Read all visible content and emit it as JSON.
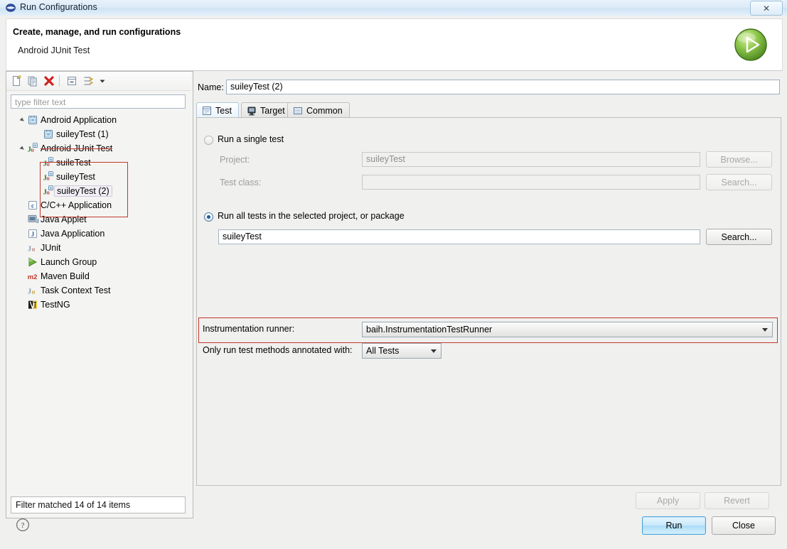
{
  "window": {
    "title": "Run Configurations",
    "icon": "eclipse-icon",
    "close_label": "✕"
  },
  "header": {
    "title": "Create, manage, and run configurations",
    "subtitle": "Android JUnit Test",
    "run_icon": "green-run-icon"
  },
  "sidebar": {
    "toolbar": [
      {
        "name": "new-configuration-icon",
        "label": "New launch configuration"
      },
      {
        "name": "duplicate-configuration-icon",
        "label": "Duplicate"
      },
      {
        "name": "delete-configuration-icon",
        "label": "Delete"
      },
      {
        "name": "collapse-all-icon",
        "label": "Collapse All"
      },
      {
        "name": "filter-icon",
        "label": "Filter"
      },
      {
        "name": "chevron-down-icon",
        "label": "Menu"
      }
    ],
    "filter": {
      "placeholder": "type filter text",
      "value": ""
    },
    "tree": [
      {
        "label": "Android Application",
        "icon": "android-app-icon",
        "depth": 0,
        "expanded": true,
        "selected": false,
        "struck": false
      },
      {
        "label": "suileyTest (1)",
        "icon": "android-app-icon",
        "depth": 1,
        "expanded": null,
        "selected": false,
        "struck": false
      },
      {
        "label": "Android JUnit Test",
        "icon": "junit-android-icon",
        "depth": 0,
        "expanded": true,
        "selected": false,
        "struck": true
      },
      {
        "label": "suileTest",
        "icon": "junit-android-icon",
        "depth": 1,
        "expanded": null,
        "selected": false,
        "struck": false
      },
      {
        "label": "suileyTest",
        "icon": "junit-android-icon",
        "depth": 1,
        "expanded": null,
        "selected": false,
        "struck": false
      },
      {
        "label": "suileyTest (2)",
        "icon": "junit-android-icon",
        "depth": 1,
        "expanded": null,
        "selected": true,
        "struck": false
      },
      {
        "label": "C/C++ Application",
        "icon": "cpp-icon",
        "depth": 0,
        "expanded": null,
        "selected": false,
        "struck": false
      },
      {
        "label": "Java Applet",
        "icon": "java-applet-icon",
        "depth": 0,
        "expanded": null,
        "selected": false,
        "struck": false
      },
      {
        "label": "Java Application",
        "icon": "java-app-icon",
        "depth": 0,
        "expanded": null,
        "selected": false,
        "struck": false
      },
      {
        "label": "JUnit",
        "icon": "junit-icon",
        "depth": 0,
        "expanded": null,
        "selected": false,
        "struck": false
      },
      {
        "label": "Launch Group",
        "icon": "launch-group-icon",
        "depth": 0,
        "expanded": null,
        "selected": false,
        "struck": false
      },
      {
        "label": "Maven Build",
        "icon": "maven-icon",
        "depth": 0,
        "expanded": null,
        "selected": false,
        "struck": false
      },
      {
        "label": "Task Context Test",
        "icon": "task-context-icon",
        "depth": 0,
        "expanded": null,
        "selected": false,
        "struck": false
      },
      {
        "label": "TestNG",
        "icon": "testng-icon",
        "depth": 0,
        "expanded": null,
        "selected": false,
        "struck": false
      }
    ],
    "status": "Filter matched 14 of 14 items"
  },
  "main": {
    "name_label": "Name:",
    "name_value": "suileyTest (2)",
    "tabs": [
      {
        "label": "Test",
        "icon": "test-tab-icon",
        "active": true
      },
      {
        "label": "Target",
        "icon": "target-tab-icon",
        "active": false
      },
      {
        "label": "Common",
        "icon": "common-tab-icon",
        "active": false
      }
    ],
    "single_test": {
      "radio_label": "Run a single test",
      "selected": false,
      "project_label": "Project:",
      "project_value": "suileyTest",
      "project_button": "Browse...",
      "testclass_label": "Test class:",
      "testclass_value": "",
      "testclass_button": "Search..."
    },
    "all_tests": {
      "radio_label": "Run all tests in the selected project, or package",
      "selected": true,
      "value": "suileyTest",
      "button": "Search..."
    },
    "runner": {
      "label": "Instrumentation runner:",
      "value": "baih.InstrumentationTestRunner"
    },
    "annotated": {
      "label": "Only run test methods annotated with:",
      "value": "All Tests"
    },
    "apply_label": "Apply",
    "revert_label": "Revert"
  },
  "footer": {
    "help_icon": "help-icon",
    "run_label": "Run",
    "close_label": "Close"
  },
  "annotations": {
    "highlight_color": "#c0392b"
  }
}
